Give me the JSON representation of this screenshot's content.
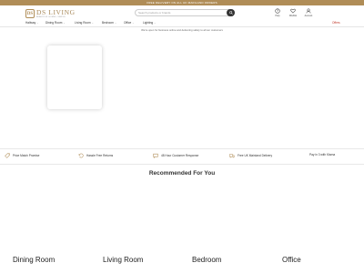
{
  "promo": {
    "text": "FREE DELIVERY ON ALL UK MAINLAND ORDERS"
  },
  "brand": {
    "logo_mark": "DS",
    "name": "DS LIVING",
    "tagline": "BEAUTIFUL HOMES, SIMPLE"
  },
  "search": {
    "placeholder": "Search products or brands"
  },
  "header": {
    "actions": [
      {
        "label": "Help",
        "icon": "help-icon"
      },
      {
        "label": "Wishlist",
        "icon": "heart-icon"
      },
      {
        "label": "Account",
        "icon": "user-icon"
      }
    ]
  },
  "nav": {
    "items": [
      {
        "label": "Hallway"
      },
      {
        "label": "Dining Room"
      },
      {
        "label": "Living Room"
      },
      {
        "label": "Bedroom"
      },
      {
        "label": "Office"
      },
      {
        "label": "Lighting"
      }
    ],
    "offers": "Offers"
  },
  "notice": "We're open for business online and delivering safely to all our customers",
  "usps": [
    {
      "label": "Price Match Promise",
      "icon": "tag-icon"
    },
    {
      "label": "Hassle Free Returns",
      "icon": "returns-icon"
    },
    {
      "label": "48 Hour Customer Response",
      "icon": "chat-icon"
    },
    {
      "label": "Free UK Mainland Delivery",
      "icon": "truck-icon"
    },
    {
      "label": "Pay in 3 with Klarna",
      "icon": ""
    }
  ],
  "recommended": {
    "title": "Recommended For You"
  },
  "categories": [
    {
      "label": "Dining Room"
    },
    {
      "label": "Living Room"
    },
    {
      "label": "Bedroom"
    },
    {
      "label": "Office"
    }
  ],
  "colors": {
    "brand": "#b08d57",
    "offers": "#c0392b"
  }
}
